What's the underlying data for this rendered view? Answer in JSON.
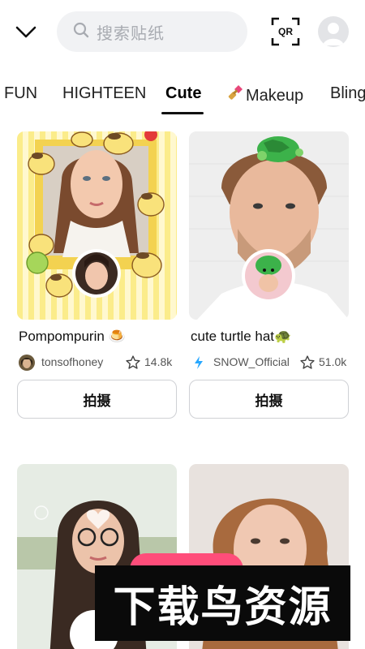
{
  "search": {
    "placeholder": "搜索贴纸"
  },
  "header": {
    "qr_label": "QR"
  },
  "tabs": [
    {
      "label": "FUN"
    },
    {
      "label": "HIGHTEEN"
    },
    {
      "label": "Cute",
      "active": true
    },
    {
      "label": "Makeup",
      "icon": "lipstick-icon"
    },
    {
      "label": "Bling"
    }
  ],
  "stickers": [
    {
      "title": "Pompompurin 🍮",
      "author": "tonsofhoney",
      "likes": "14.8k",
      "action": "拍摄"
    },
    {
      "title": "cute turtle hat🐢",
      "author": "SNOW_Official",
      "likes": "51.0k",
      "action": "拍摄"
    },
    {
      "title": "",
      "author": "",
      "likes": "",
      "action": ""
    },
    {
      "title": "",
      "author": "",
      "likes": "",
      "action": ""
    }
  ],
  "watermark": {
    "text": "下载鸟资源"
  },
  "colors": {
    "accent_pink": "#ff4d7a",
    "snow_blue": "#28a8ff",
    "search_bg": "#f1f2f4"
  }
}
